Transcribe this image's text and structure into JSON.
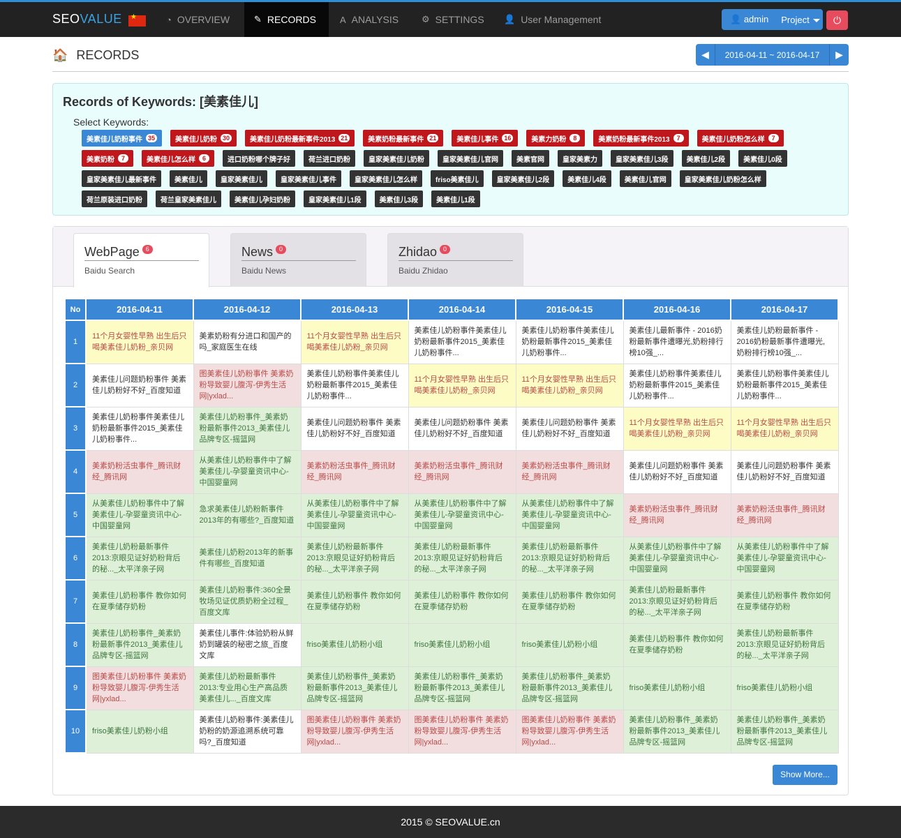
{
  "nav": {
    "brand_a": "SEO",
    "brand_b": "VALUE",
    "items": [
      {
        "label": "OVERVIEW",
        "icon": "dashboard-icon",
        "glyph": "◔"
      },
      {
        "label": "RECORDS",
        "icon": "pencil-icon",
        "glyph": "✎"
      },
      {
        "label": "ANALYSIS",
        "icon": "font-icon",
        "glyph": "A"
      },
      {
        "label": "SETTINGS",
        "icon": "gear-icon",
        "glyph": "⚙"
      },
      {
        "label": "User Management",
        "icon": "user-icon",
        "glyph": "👤"
      }
    ],
    "admin_label": "admin",
    "project_label": "Project",
    "power_glyph": "⏻"
  },
  "header": {
    "title": "RECORDS",
    "date_range": "2016-04-11 ~ 2016-04-17",
    "prev": "◀",
    "next": "▶"
  },
  "keywords": {
    "title": "Records of Keywords: [美素佳儿]",
    "select_label": "Select Keywords:",
    "rows": [
      [
        {
          "label": "美素佳儿奶粉事件",
          "count": "35",
          "style": "blue"
        },
        {
          "label": "美素佳儿奶粉",
          "count": "30",
          "style": "red"
        },
        {
          "label": "美素佳儿奶粉最新事件2013",
          "count": "21",
          "style": "red"
        },
        {
          "label": "美素奶粉最新事件",
          "count": "21",
          "style": "red"
        },
        {
          "label": "美素佳儿事件",
          "count": "16",
          "style": "red"
        },
        {
          "label": "美素力奶粉",
          "count": "8",
          "style": "red"
        },
        {
          "label": "美素奶粉最新事件2013",
          "count": "7",
          "style": "red"
        },
        {
          "label": "美素佳儿奶粉怎么样",
          "count": "7",
          "style": "red"
        }
      ],
      [
        {
          "label": "美素奶粉",
          "count": "7",
          "style": "red"
        },
        {
          "label": "美素佳儿怎么样",
          "count": "6",
          "style": "red"
        },
        {
          "label": "进口奶粉哪个牌子好",
          "count": "",
          "style": "dark"
        },
        {
          "label": "荷兰进口奶粉",
          "count": "",
          "style": "dark"
        },
        {
          "label": "皇家美素佳儿奶粉",
          "count": "",
          "style": "dark"
        },
        {
          "label": "皇家美素佳儿官网",
          "count": "",
          "style": "dark"
        },
        {
          "label": "美素官网",
          "count": "",
          "style": "dark"
        },
        {
          "label": "皇家美素力",
          "count": "",
          "style": "dark"
        },
        {
          "label": "皇家美素佳儿3段",
          "count": "",
          "style": "dark"
        },
        {
          "label": "美素佳儿2段",
          "count": "",
          "style": "dark"
        },
        {
          "label": "美素佳儿0段",
          "count": "",
          "style": "dark"
        }
      ],
      [
        {
          "label": "皇家美素佳儿最新事件",
          "count": "",
          "style": "dark"
        },
        {
          "label": "美素佳儿",
          "count": "",
          "style": "dark"
        },
        {
          "label": "皇家美素佳儿",
          "count": "",
          "style": "dark"
        },
        {
          "label": "皇家美素佳儿事件",
          "count": "",
          "style": "dark"
        },
        {
          "label": "皇家美素佳儿怎么样",
          "count": "",
          "style": "dark"
        },
        {
          "label": "friso美素佳儿",
          "count": "",
          "style": "dark"
        },
        {
          "label": "皇家美素佳儿2段",
          "count": "",
          "style": "dark"
        },
        {
          "label": "美素佳儿4段",
          "count": "",
          "style": "dark"
        },
        {
          "label": "美素佳儿官网",
          "count": "",
          "style": "dark"
        },
        {
          "label": "皇家美素佳儿奶粉怎么样",
          "count": "",
          "style": "dark"
        }
      ],
      [
        {
          "label": "荷兰原装进口奶粉",
          "count": "",
          "style": "dark"
        },
        {
          "label": "荷兰皇家美素佳儿",
          "count": "",
          "style": "dark"
        },
        {
          "label": "美素佳儿孕妇奶粉",
          "count": "",
          "style": "dark"
        },
        {
          "label": "皇家美素佳儿1段",
          "count": "",
          "style": "dark"
        },
        {
          "label": "美素佳儿3段",
          "count": "",
          "style": "dark"
        },
        {
          "label": "美素佳儿1段",
          "count": "",
          "style": "dark"
        }
      ]
    ]
  },
  "tabs": [
    {
      "name": "WebPage",
      "badge": "6",
      "sub": "Baidu Search"
    },
    {
      "name": "News",
      "badge": "0",
      "sub": "Baidu News"
    },
    {
      "name": "Zhidao",
      "badge": "0",
      "sub": "Baidu Zhidao"
    }
  ],
  "table": {
    "no_header": "No",
    "dates": [
      "2016-04-11",
      "2016-04-12",
      "2016-04-13",
      "2016-04-14",
      "2016-04-15",
      "2016-04-16",
      "2016-04-17"
    ],
    "rows": [
      {
        "no": "1",
        "cells": [
          {
            "t": "11个月女婴性早熟 出生后只喝美素佳儿奶粉_亲贝网",
            "c": "y"
          },
          {
            "t": "美素奶粉有分进口和国产的吗_家庭医生在线",
            "c": "w"
          },
          {
            "t": "11个月女婴性早熟 出生后只喝美素佳儿奶粉_亲贝网",
            "c": "y"
          },
          {
            "t": "美素佳儿奶粉事件美素佳儿奶粉最新事件2015_美素佳儿奶粉事件...",
            "c": "w"
          },
          {
            "t": "美素佳儿奶粉事件美素佳儿奶粉最新事件2015_美素佳儿奶粉事件...",
            "c": "w"
          },
          {
            "t": "美素佳儿最新事件 - 2016奶粉最新事件遭曝光,奶粉排行榜10强_...",
            "c": "w"
          },
          {
            "t": "美素佳儿奶粉最新事件 - 2016奶粉最新事件遭曝光,奶粉排行榜10强_...",
            "c": "w"
          }
        ]
      },
      {
        "no": "2",
        "cells": [
          {
            "t": "美素佳儿问题奶粉事件 美素佳儿奶粉好不好_百度知道",
            "c": "w"
          },
          {
            "t": "图美素佳儿奶粉事件 美素奶粉导致婴儿腹泻-伊秀生活网|yxlad...",
            "c": "r"
          },
          {
            "t": "美素佳儿奶粉事件美素佳儿奶粉最新事件2015_美素佳儿奶粉事件...",
            "c": "w"
          },
          {
            "t": "11个月女婴性早熟 出生后只喝美素佳儿奶粉_亲贝网",
            "c": "y"
          },
          {
            "t": "11个月女婴性早熟 出生后只喝美素佳儿奶粉_亲贝网",
            "c": "y"
          },
          {
            "t": "美素佳儿奶粉事件美素佳儿奶粉最新事件2015_美素佳儿奶粉事件...",
            "c": "w"
          },
          {
            "t": "美素佳儿奶粉事件美素佳儿奶粉最新事件2015_美素佳儿奶粉事件...",
            "c": "w"
          }
        ]
      },
      {
        "no": "3",
        "cells": [
          {
            "t": "美素佳儿奶粉事件美素佳儿奶粉最新事件2015_美素佳儿奶粉事件...",
            "c": "w"
          },
          {
            "t": "美素佳儿奶粉事件_美素奶粉最新事件2013_美素佳儿品牌专区-摇篮网",
            "c": "g"
          },
          {
            "t": "美素佳儿问题奶粉事件 美素佳儿奶粉好不好_百度知道",
            "c": "w"
          },
          {
            "t": "美素佳儿问题奶粉事件 美素佳儿奶粉好不好_百度知道",
            "c": "w"
          },
          {
            "t": "美素佳儿问题奶粉事件 美素佳儿奶粉好不好_百度知道",
            "c": "w"
          },
          {
            "t": "11个月女婴性早熟 出生后只喝美素佳儿奶粉_亲贝网",
            "c": "y"
          },
          {
            "t": "11个月女婴性早熟 出生后只喝美素佳儿奶粉_亲贝网",
            "c": "y"
          }
        ]
      },
      {
        "no": "4",
        "cells": [
          {
            "t": "美素奶粉活虫事件_腾讯财经_腾讯网",
            "c": "r"
          },
          {
            "t": "从美素佳儿奶粉事件中了解美素佳儿-孕婴童资讯中心-中国婴童网",
            "c": "g"
          },
          {
            "t": "美素奶粉活虫事件_腾讯财经_腾讯网",
            "c": "r"
          },
          {
            "t": "美素奶粉活虫事件_腾讯财经_腾讯网",
            "c": "r"
          },
          {
            "t": "美素奶粉活虫事件_腾讯财经_腾讯网",
            "c": "r"
          },
          {
            "t": "美素佳儿问题奶粉事件 美素佳儿奶粉好不好_百度知道",
            "c": "w"
          },
          {
            "t": "美素佳儿问题奶粉事件 美素佳儿奶粉好不好_百度知道",
            "c": "w"
          }
        ]
      },
      {
        "no": "5",
        "cells": [
          {
            "t": "从美素佳儿奶粉事件中了解美素佳儿-孕婴童资讯中心-中国婴童网",
            "c": "g"
          },
          {
            "t": "急求美素佳儿奶粉新事件2013年的有哪些?_百度知道",
            "c": "g"
          },
          {
            "t": "从美素佳儿奶粉事件中了解美素佳儿-孕婴童资讯中心-中国婴童网",
            "c": "g"
          },
          {
            "t": "从美素佳儿奶粉事件中了解美素佳儿-孕婴童资讯中心-中国婴童网",
            "c": "g"
          },
          {
            "t": "从美素佳儿奶粉事件中了解美素佳儿-孕婴童资讯中心-中国婴童网",
            "c": "g"
          },
          {
            "t": "美素奶粉活虫事件_腾讯财经_腾讯网",
            "c": "r"
          },
          {
            "t": "美素奶粉活虫事件_腾讯财经_腾讯网",
            "c": "r"
          }
        ]
      },
      {
        "no": "6",
        "cells": [
          {
            "t": "美素佳儿奶粉最新事件2013:京眼见证好奶粉背后的秘..._太平洋亲子网",
            "c": "g"
          },
          {
            "t": "美素佳儿奶粉2013年的新事件有哪些_百度知道",
            "c": "g"
          },
          {
            "t": "美素佳儿奶粉最新事件2013:京眼见证好奶粉背后的秘..._太平洋亲子网",
            "c": "g"
          },
          {
            "t": "美素佳儿奶粉最新事件2013:京眼见证好奶粉背后的秘..._太平洋亲子网",
            "c": "g"
          },
          {
            "t": "美素佳儿奶粉最新事件2013:京眼见证好奶粉背后的秘..._太平洋亲子网",
            "c": "g"
          },
          {
            "t": "从美素佳儿奶粉事件中了解美素佳儿-孕婴童资讯中心-中国婴童网",
            "c": "g"
          },
          {
            "t": "从美素佳儿奶粉事件中了解美素佳儿-孕婴童资讯中心-中国婴童网",
            "c": "g"
          }
        ]
      },
      {
        "no": "7",
        "cells": [
          {
            "t": "美素佳儿奶粉事件 教你如何在夏季储存奶粉",
            "c": "g"
          },
          {
            "t": "美素佳儿奶粉事件:360全景牧场见证优质奶粉全过程_百度文库",
            "c": "g"
          },
          {
            "t": "美素佳儿奶粉事件 教你如何在夏季储存奶粉",
            "c": "g"
          },
          {
            "t": "美素佳儿奶粉事件 教你如何在夏季储存奶粉",
            "c": "g"
          },
          {
            "t": "美素佳儿奶粉事件 教你如何在夏季储存奶粉",
            "c": "g"
          },
          {
            "t": "美素佳儿奶粉最新事件2013:京眼见证好奶粉背后的秘..._太平洋亲子网",
            "c": "g"
          },
          {
            "t": "美素佳儿奶粉事件 教你如何在夏季储存奶粉",
            "c": "g"
          }
        ]
      },
      {
        "no": "8",
        "cells": [
          {
            "t": "美素佳儿奶粉事件_美素奶粉最新事件2013_美素佳儿品牌专区-摇篮网",
            "c": "g"
          },
          {
            "t": "美素佳儿事件:体验奶粉从鲜奶到罐装的秘密之旅_百度文库",
            "c": "w"
          },
          {
            "t": "friso美素佳儿奶粉小组",
            "c": "g"
          },
          {
            "t": "friso美素佳儿奶粉小组",
            "c": "g"
          },
          {
            "t": "friso美素佳儿奶粉小组",
            "c": "g"
          },
          {
            "t": "美素佳儿奶粉事件 教你如何在夏季储存奶粉",
            "c": "g"
          },
          {
            "t": "美素佳儿奶粉最新事件2013:京眼见证好奶粉背后的秘..._太平洋亲子网",
            "c": "g"
          }
        ]
      },
      {
        "no": "9",
        "cells": [
          {
            "t": "图美素佳儿奶粉事件 美素奶粉导致婴儿腹泻-伊秀生活网|yxlad...",
            "c": "r"
          },
          {
            "t": "美素佳儿奶粉最新事件2013:专业用心生产高品质美素佳儿..._百度文库",
            "c": "g"
          },
          {
            "t": "美素佳儿奶粉事件_美素奶粉最新事件2013_美素佳儿品牌专区-摇篮网",
            "c": "g"
          },
          {
            "t": "美素佳儿奶粉事件_美素奶粉最新事件2013_美素佳儿品牌专区-摇篮网",
            "c": "g"
          },
          {
            "t": "美素佳儿奶粉事件_美素奶粉最新事件2013_美素佳儿品牌专区-摇篮网",
            "c": "g"
          },
          {
            "t": "friso美素佳儿奶粉小组",
            "c": "g"
          },
          {
            "t": "friso美素佳儿奶粉小组",
            "c": "g"
          }
        ]
      },
      {
        "no": "10",
        "cells": [
          {
            "t": "friso美素佳儿奶粉小组",
            "c": "g"
          },
          {
            "t": "美素佳儿奶粉事件:美素佳儿奶粉的奶源追溯系统可靠吗?_百度知道",
            "c": "w"
          },
          {
            "t": "图美素佳儿奶粉事件 美素奶粉导致婴儿腹泻-伊秀生活网|yxlad...",
            "c": "r"
          },
          {
            "t": "图美素佳儿奶粉事件 美素奶粉导致婴儿腹泻-伊秀生活网|yxlad...",
            "c": "r"
          },
          {
            "t": "图美素佳儿奶粉事件 美素奶粉导致婴儿腹泻-伊秀生活网|yxlad...",
            "c": "r"
          },
          {
            "t": "美素佳儿奶粉事件_美素奶粉最新事件2013_美素佳儿品牌专区-摇篮网",
            "c": "g"
          },
          {
            "t": "美素佳儿奶粉事件_美素奶粉最新事件2013_美素佳儿品牌专区-摇篮网",
            "c": "g"
          }
        ]
      }
    ]
  },
  "show_more": "Show More...",
  "footer": "2015 © SEOVALUE.cn"
}
